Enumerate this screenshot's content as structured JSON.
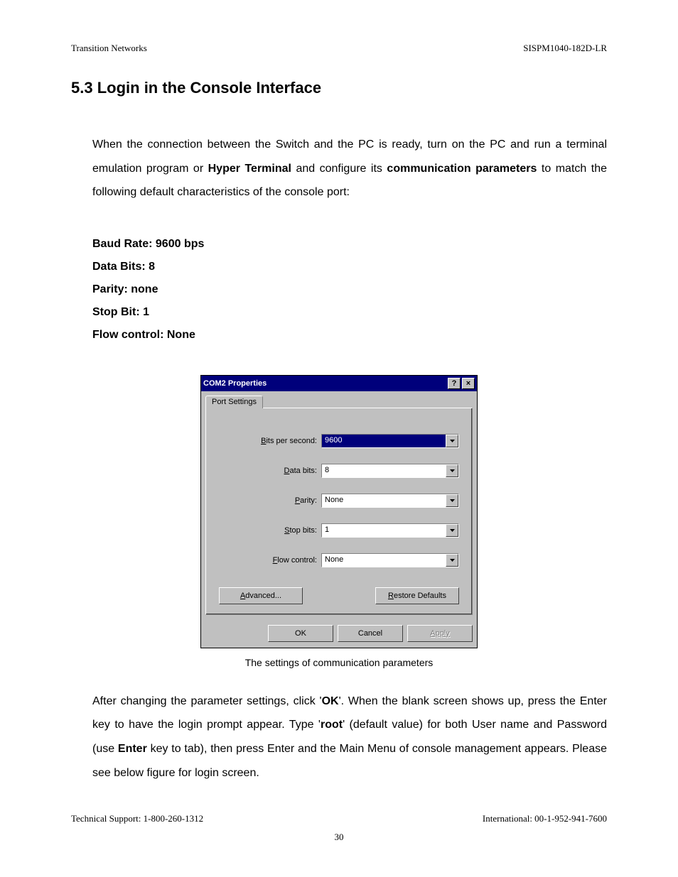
{
  "header": {
    "left": "Transition Networks",
    "right": "SISPM1040-182D-LR"
  },
  "section": {
    "number": "5.3",
    "title": "Login in the Console Interface"
  },
  "intro": {
    "pre": "When the connection between the Switch and the PC is ready, turn on the PC and run a terminal emulation program or ",
    "b1": "Hyper Terminal",
    "mid1": " and configure its ",
    "b2": "communication parameters",
    "post": " to match the following default characteristics of the console port:"
  },
  "params": [
    "Baud Rate: 9600 bps",
    "Data Bits: 8",
    "Parity: none",
    "Stop Bit: 1",
    "Flow control: None"
  ],
  "dialog": {
    "title": "COM2 Properties",
    "help_icon": "?",
    "close_icon": "×",
    "tab": "Port Settings",
    "rows": [
      {
        "label_u": "B",
        "label_rest": "its per second:",
        "value": "9600",
        "selected": true
      },
      {
        "label_u": "D",
        "label_rest": "ata bits:",
        "value": "8",
        "selected": false
      },
      {
        "label_u": "P",
        "label_rest": "arity:",
        "value": "None",
        "selected": false
      },
      {
        "label_u": "S",
        "label_rest": "top bits:",
        "value": "1",
        "selected": false
      },
      {
        "label_u": "F",
        "label_rest": "low control:",
        "value": "None",
        "selected": false
      }
    ],
    "advanced_u": "A",
    "advanced_rest": "dvanced...",
    "restore_u": "R",
    "restore_rest": "estore Defaults",
    "ok": "OK",
    "cancel": "Cancel",
    "apply": "Apply"
  },
  "caption": "The settings of communication parameters",
  "after": {
    "t1": "After changing the parameter settings, click '",
    "b1": "OK",
    "t2": "'. When the blank screen shows up, press the Enter key to have the login prompt appear. Type '",
    "b2": "root",
    "t3": "' (default value) for both User name and Password (use ",
    "b3": "Enter",
    "t4": " key to tab), then press Enter and the Main Menu of console management appears. Please see below figure for login screen."
  },
  "footer": {
    "left": "Technical Support: 1-800-260-1312",
    "right": "International: 00-1-952-941-7600",
    "page": "30"
  }
}
